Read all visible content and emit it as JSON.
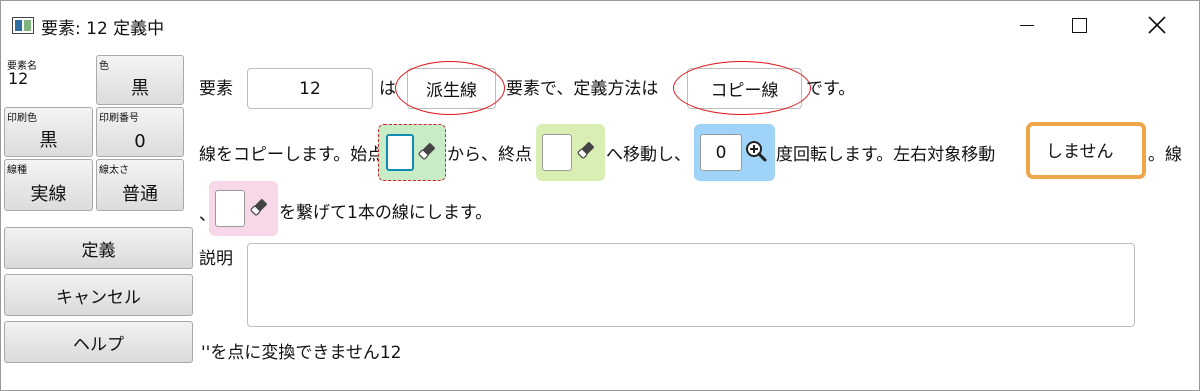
{
  "window": {
    "title": "要素: 12 定義中"
  },
  "sidebar": {
    "element_name": {
      "label": "要素名",
      "value": "12"
    },
    "color": {
      "label": "色",
      "value": "黒"
    },
    "print_color": {
      "label": "印刷色",
      "value": "黒"
    },
    "print_number": {
      "label": "印刷番号",
      "value": "0"
    },
    "line_type": {
      "label": "線種",
      "value": "実線"
    },
    "line_width": {
      "label": "線太さ",
      "value": "普通"
    },
    "buttons": {
      "define": "定義",
      "cancel": "キャンセル",
      "help": "ヘルプ"
    }
  },
  "main": {
    "row1": {
      "prefix": "要素",
      "element_value": "12",
      "wa": "は",
      "derived_type": "派生線",
      "mid": "要素で、定義方法は",
      "method": "コピー線",
      "suffix": "です。"
    },
    "row2": {
      "start_text": "線をコピーします。始点",
      "start_value": "",
      "from_text": "から、終点",
      "end_value": "",
      "move_text": "へ移動し、",
      "angle_value": "0",
      "rotate_text": "度回転します。左右対象移動",
      "mirror_value": "しません",
      "tail": "。線"
    },
    "row3": {
      "lead": "、",
      "connect_value": "",
      "text": "を繋げて1本の線にします。"
    },
    "description": {
      "label": "説明",
      "value": ""
    },
    "status": "''を点に変換できません12"
  },
  "icons": {
    "eraser": "eraser-icon",
    "zoom": "zoom-in-icon"
  }
}
